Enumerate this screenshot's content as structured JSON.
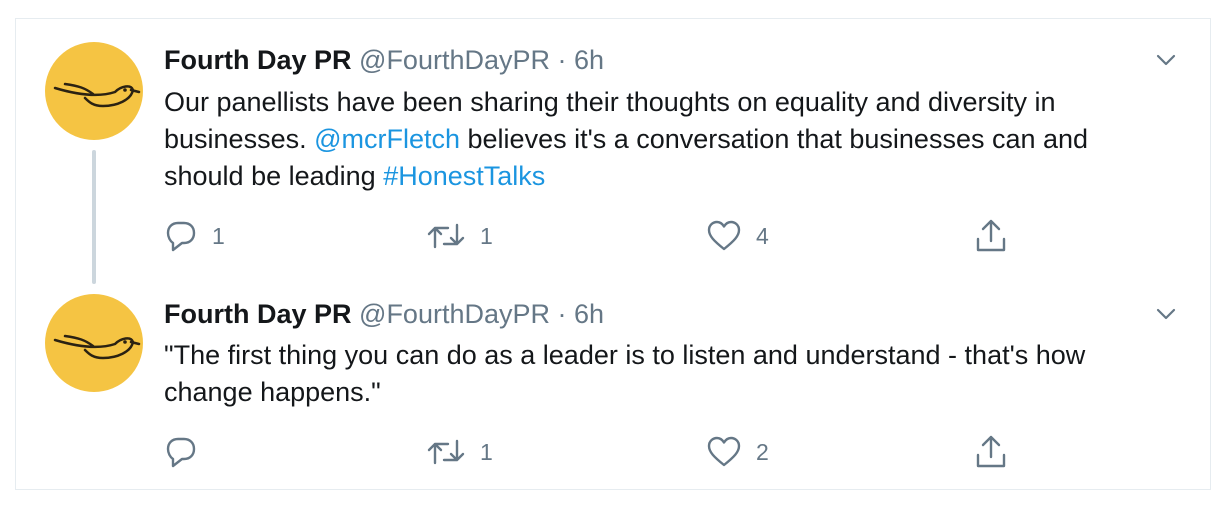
{
  "tweets": [
    {
      "name": "Fourth Day PR",
      "handle": "@FourthDayPR",
      "separator": "·",
      "time": "6h",
      "text_parts": [
        "Our panellists have been sharing their thoughts on equality and diversity in businesses. ",
        "@mcrFletch",
        " believes it's a conversation that businesses can and should be leading ",
        "#HonestTalks"
      ],
      "replies": "1",
      "retweets": "1",
      "likes": "4"
    },
    {
      "name": "Fourth Day PR",
      "handle": "@FourthDayPR",
      "separator": "·",
      "time": "6h",
      "text": "\"The first thing you can do as a leader is to listen and understand - that's how change happens.\"",
      "replies": "",
      "retweets": "1",
      "likes": "2"
    }
  ],
  "icons": {
    "reply": "reply-icon",
    "retweet": "retweet-icon",
    "like": "heart-icon",
    "share": "share-icon",
    "caret": "chevron-down-icon",
    "avatar": "bird-logo"
  },
  "colors": {
    "avatar_bg": "#f5c443",
    "link": "#1b95e0",
    "secondary_text": "#657786"
  }
}
